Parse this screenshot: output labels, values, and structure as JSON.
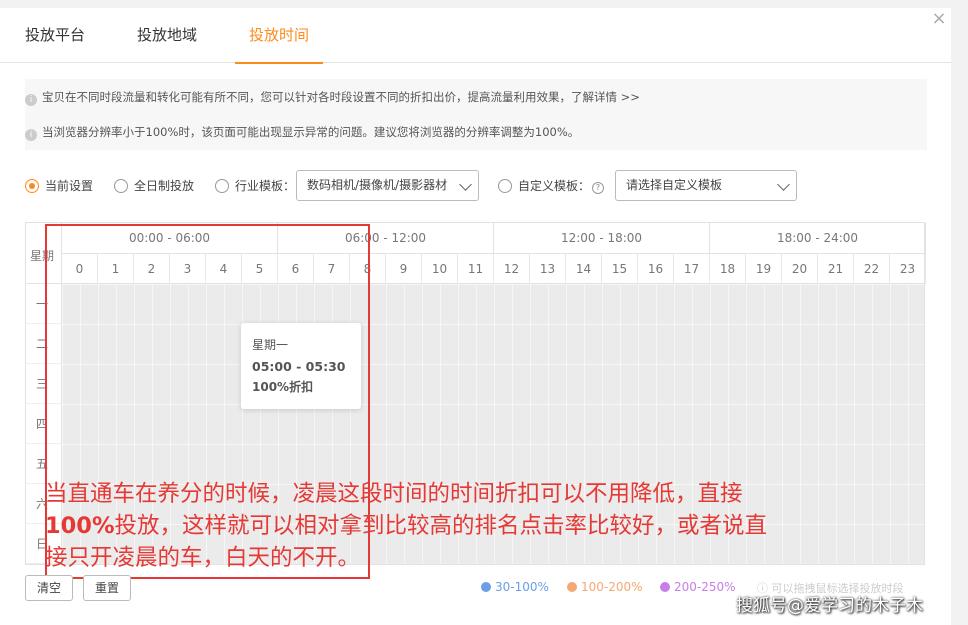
{
  "tabs": [
    "投放平台",
    "投放地域",
    "投放时间"
  ],
  "notices": [
    "宝贝在不同时段流量和转化可能有所不同，您可以针对各时段设置不同的折扣出价，提高流量利用效果，了解详情 >>",
    "当浏览器分辨率小于100%时，该页面可能出现显示异常的问题。建议您将浏览器的分辨率调整为100%。"
  ],
  "options": {
    "current": "当前设置",
    "allday": "全日制投放",
    "industry": "行业模板：",
    "industry_value": "数码相机/摄像机/摄影器材",
    "custom": "自定义模板：",
    "custom_placeholder": "请选择自定义模板"
  },
  "grid": {
    "corner": "星期",
    "ranges": [
      "00:00 - 06:00",
      "06:00 - 12:00",
      "12:00 - 18:00",
      "18:00 - 24:00"
    ],
    "hours": [
      "0",
      "1",
      "2",
      "3",
      "4",
      "5",
      "6",
      "7",
      "8",
      "9",
      "10",
      "11",
      "12",
      "13",
      "14",
      "15",
      "16",
      "17",
      "18",
      "19",
      "20",
      "21",
      "22",
      "23"
    ],
    "days": [
      "一",
      "二",
      "三",
      "四",
      "五",
      "六",
      "日"
    ]
  },
  "tooltip": {
    "day": "星期一",
    "time": "05:00 - 05:30",
    "pct": "100%折扣"
  },
  "caption": {
    "line1": "当直通车在养分的时候，凌晨这段时间的时间折扣可以不用降低，直接",
    "line2_bold": "100%",
    "line2_rest": "投放，这样就可以相对拿到比较高的排名点击率比较好，或者说直",
    "line3": "接只开凌晨的车，白天的不开。"
  },
  "buttons": {
    "clear": "清空",
    "reset": "重置"
  },
  "legend": [
    {
      "label": "30-100%",
      "color": "#6a9ee8"
    },
    {
      "label": "100-200%",
      "color": "#f5a873"
    },
    {
      "label": "200-250%",
      "color": "#c77ee8"
    }
  ],
  "hint": "可以拖拽鼠标选择投放时段",
  "watermark": "搜狐号@爱学习的木子木",
  "colors": {
    "accent": "#ff8a1c",
    "annotation": "#e53935"
  }
}
